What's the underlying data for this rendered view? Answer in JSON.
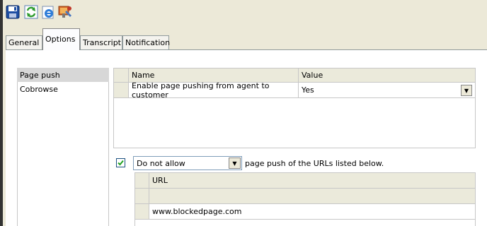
{
  "toolbar": {
    "icons": [
      "save-icon",
      "refresh-icon",
      "browser-icon",
      "tools-icon"
    ]
  },
  "tabs": [
    {
      "label": "General"
    },
    {
      "label": "Options",
      "selected": true
    },
    {
      "label": "Transcript"
    },
    {
      "label": "Notification"
    }
  ],
  "nav": {
    "items": [
      {
        "label": "Page push",
        "selected": true
      },
      {
        "label": "Cobrowse"
      }
    ]
  },
  "settings_grid": {
    "headers": {
      "name": "Name",
      "value": "Value"
    },
    "rows": [
      {
        "name": "Enable page pushing from agent to customer",
        "value": "Yes"
      }
    ]
  },
  "page_push": {
    "enabled": true,
    "mode": "Do not allow",
    "suffix": "page push of the URLs listed below."
  },
  "url_grid": {
    "header": "URL",
    "rows": [
      "",
      "www.blockedpage.com"
    ]
  },
  "colors": {
    "window_bg": "#ECE9D8",
    "panel_bg": "#FFFFFF",
    "grid_header_bg": "#EBEADB",
    "selected_nav_bg": "#D7D7D7",
    "check_color": "#21A121"
  }
}
